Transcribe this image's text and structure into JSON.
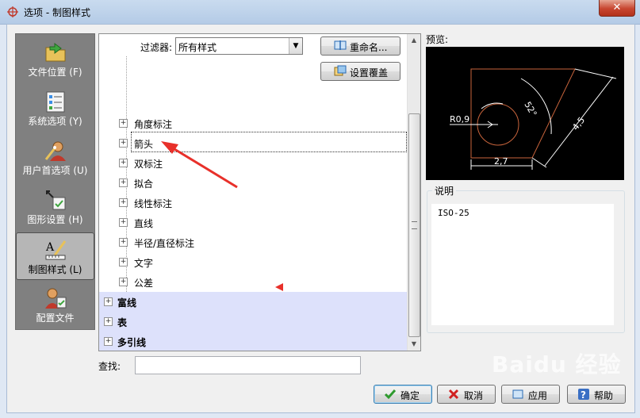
{
  "window": {
    "title": "选项 - 制图样式",
    "close_glyph": "✕"
  },
  "nav": {
    "items": [
      {
        "label": "文件位置 (F)",
        "icon": "folder-arrow-icon",
        "active": false
      },
      {
        "label": "系统选项 (Y)",
        "icon": "checklist-icon",
        "active": false
      },
      {
        "label": "用户首选项 (U)",
        "icon": "user-wand-icon",
        "active": false
      },
      {
        "label": "图形设置 (H)",
        "icon": "graphics-settings-icon",
        "active": false
      },
      {
        "label": "制图样式 (L)",
        "icon": "drafting-style-icon",
        "active": true
      },
      {
        "label": "配置文件",
        "icon": "profile-user-icon",
        "active": false
      }
    ]
  },
  "filter": {
    "label": "过滤器:",
    "value": "所有样式"
  },
  "buttons": {
    "rename": "重命名...",
    "override": "设置覆盖"
  },
  "tree": {
    "children": [
      {
        "label": "角度标注"
      },
      {
        "label": "箭头"
      },
      {
        "label": "双标注"
      },
      {
        "label": "拟合"
      },
      {
        "label": "线性标注"
      },
      {
        "label": "直线"
      },
      {
        "label": "半径/直径标注"
      },
      {
        "label": "文字"
      },
      {
        "label": "公差"
      }
    ],
    "groups": [
      {
        "label": "富线"
      },
      {
        "label": "表"
      },
      {
        "label": "多引线"
      }
    ],
    "expand_glyph": "+"
  },
  "preview": {
    "label": "预览:",
    "dims": {
      "radius": "R0,9",
      "angle": "52°",
      "length": "4,5",
      "width": "2,7"
    }
  },
  "description": {
    "legend": "说明",
    "text": "ISO-25"
  },
  "search": {
    "label": "查找:",
    "value": ""
  },
  "dialog_buttons": {
    "ok": "确定",
    "cancel": "取消",
    "apply": "应用",
    "help": "帮助"
  },
  "watermark": "Baidu 经验",
  "colors": {
    "nav_bg": "#808080",
    "group_bg": "#dde1fb",
    "annotation_red": "#e8302a",
    "preview_lines": "#c8643c"
  }
}
